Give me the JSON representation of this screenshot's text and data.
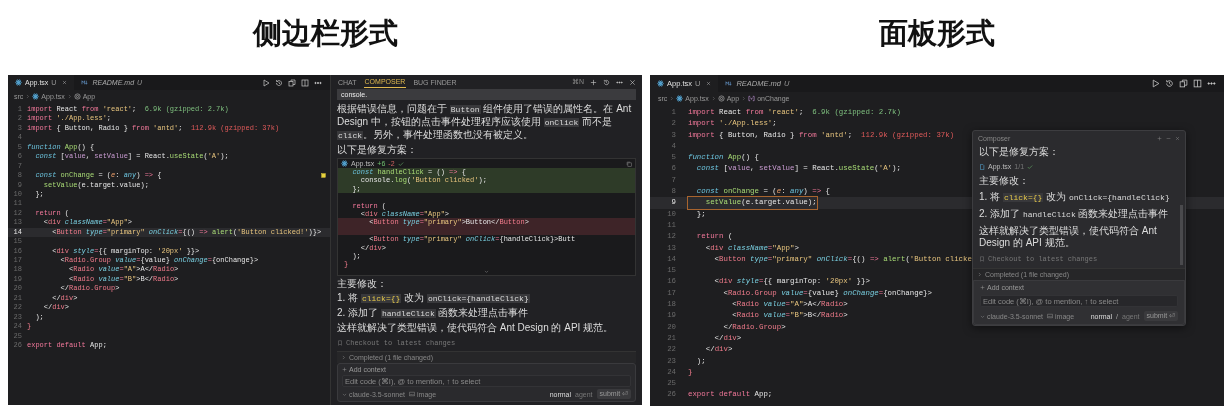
{
  "sections": [
    {
      "title": "侧边栏形式",
      "kind": "sidebar",
      "editor": {
        "tabs": [
          {
            "label": "App.tsx",
            "status": "U",
            "selected": true,
            "preview": false,
            "closable": true
          },
          {
            "label": "README.md",
            "status": "U",
            "selected": false,
            "preview": true,
            "closable": false
          }
        ],
        "breadcrumbs": [
          {
            "label": "src"
          },
          {
            "label": "App.tsx"
          },
          {
            "label": "App"
          }
        ],
        "lines": [
          {
            "number": "1",
            "current": false,
            "tokens": [
              {
                "kind": "kw",
                "text": "import"
              },
              {
                "kind": "txt",
                "text": " React "
              },
              {
                "kind": "kw",
                "text": "from"
              },
              {
                "kind": "str",
                "text": " 'react'"
              },
              {
                "kind": "txt",
                "text": ";  "
              },
              {
                "kind": "ok",
                "text": "6.9k (gzipped: 2.7k)"
              }
            ]
          },
          {
            "number": "2",
            "current": false,
            "tokens": [
              {
                "kind": "kw",
                "text": "import"
              },
              {
                "kind": "str",
                "text": " './App.less'"
              },
              {
                "kind": "txt",
                "text": ";"
              }
            ]
          },
          {
            "number": "3",
            "current": false,
            "tokens": [
              {
                "kind": "kw",
                "text": "import"
              },
              {
                "kind": "txt",
                "text": " { Button, Radio } "
              },
              {
                "kind": "kw",
                "text": "from"
              },
              {
                "kind": "str",
                "text": " 'antd'"
              },
              {
                "kind": "txt",
                "text": ";  "
              },
              {
                "kind": "big",
                "text": "112.9k (gzipped: 37k)"
              }
            ]
          },
          {
            "number": "4",
            "current": false
          },
          {
            "number": "5",
            "current": false,
            "tokens": [
              {
                "kind": "sto",
                "text": "function"
              },
              {
                "kind": "fn",
                "text": " App"
              },
              {
                "kind": "txt",
                "text": "() {"
              }
            ]
          },
          {
            "number": "6",
            "current": false,
            "tokens": [
              {
                "kind": "sto",
                "text": "  const"
              },
              {
                "kind": "txt",
                "text": " ["
              },
              {
                "kind": "var",
                "text": "value"
              },
              {
                "kind": "txt",
                "text": ", "
              },
              {
                "kind": "var",
                "text": "setValue"
              },
              {
                "kind": "txt",
                "text": "] = React."
              },
              {
                "kind": "fn",
                "text": "useState"
              },
              {
                "kind": "txt",
                "text": "("
              },
              {
                "kind": "str",
                "text": "'A'"
              },
              {
                "kind": "txt",
                "text": ");"
              }
            ]
          },
          {
            "number": "7",
            "current": false
          },
          {
            "number": "8",
            "current": false,
            "tokens": [
              {
                "kind": "sto",
                "text": "  const"
              },
              {
                "kind": "fn",
                "text": " onChange"
              },
              {
                "kind": "txt",
                "text": " = ("
              },
              {
                "kind": "param",
                "text": "e"
              },
              {
                "kind": "txt",
                "text": ": "
              },
              {
                "kind": "sto",
                "text": "any"
              },
              {
                "kind": "txt",
                "text": ") "
              },
              {
                "kind": "kw",
                "text": "=>"
              },
              {
                "kind": "txt",
                "text": " {"
              }
            ]
          },
          {
            "number": "9",
            "current": false,
            "tokens": [
              {
                "kind": "fn",
                "text": "    setValue"
              },
              {
                "kind": "txt",
                "text": "(e.target.value);"
              }
            ]
          },
          {
            "number": "10",
            "current": false,
            "tokens": [
              {
                "kind": "txt",
                "text": "  };"
              }
            ]
          },
          {
            "number": "11",
            "current": false
          },
          {
            "number": "12",
            "current": false,
            "tokens": [
              {
                "kind": "kw",
                "text": "  return"
              },
              {
                "kind": "txt",
                "text": " ("
              }
            ]
          },
          {
            "number": "13",
            "current": false,
            "tokens": [
              {
                "kind": "txt",
                "text": "    <"
              },
              {
                "kind": "tag",
                "text": "div"
              },
              {
                "kind": "attr",
                "text": " className"
              },
              {
                "kind": "kw",
                "text": "="
              },
              {
                "kind": "str",
                "text": "\"App\""
              },
              {
                "kind": "txt",
                "text": ">"
              }
            ]
          },
          {
            "number": "14",
            "current": true,
            "tokens": [
              {
                "kind": "txt",
                "text": "      <"
              },
              {
                "kind": "tag",
                "text": "Button"
              },
              {
                "kind": "attr",
                "text": " type"
              },
              {
                "kind": "kw",
                "text": "="
              },
              {
                "kind": "str",
                "text": "\"primary\""
              },
              {
                "kind": "attr",
                "text": " onClick"
              },
              {
                "kind": "kw",
                "text": "="
              },
              {
                "kind": "txt",
                "text": "{() "
              },
              {
                "kind": "kw",
                "text": "=>"
              },
              {
                "kind": "fn",
                "text": " alert"
              },
              {
                "kind": "txt",
                "text": "("
              },
              {
                "kind": "str",
                "text": "'Button clicked!'"
              },
              {
                "kind": "txt",
                "text": ")}>"
              }
            ]
          },
          {
            "number": "15",
            "current": false
          },
          {
            "number": "16",
            "current": false,
            "tokens": [
              {
                "kind": "txt",
                "text": "      <"
              },
              {
                "kind": "tag",
                "text": "div"
              },
              {
                "kind": "attr",
                "text": " style"
              },
              {
                "kind": "kw",
                "text": "="
              },
              {
                "kind": "txt",
                "text": "{{ marginTop: "
              },
              {
                "kind": "str",
                "text": "'20px'"
              },
              {
                "kind": "txt",
                "text": " }}>"
              }
            ]
          },
          {
            "number": "17",
            "current": false,
            "tokens": [
              {
                "kind": "txt",
                "text": "        <"
              },
              {
                "kind": "tag",
                "text": "Radio.Group"
              },
              {
                "kind": "attr",
                "text": " value"
              },
              {
                "kind": "kw",
                "text": "="
              },
              {
                "kind": "txt",
                "text": "{value} "
              },
              {
                "kind": "attr",
                "text": "onChange"
              },
              {
                "kind": "kw",
                "text": "="
              },
              {
                "kind": "txt",
                "text": "{onChange}>"
              }
            ]
          },
          {
            "number": "18",
            "current": false,
            "tokens": [
              {
                "kind": "txt",
                "text": "          <"
              },
              {
                "kind": "tag",
                "text": "Radio"
              },
              {
                "kind": "attr",
                "text": " value"
              },
              {
                "kind": "kw",
                "text": "="
              },
              {
                "kind": "str",
                "text": "\"A\""
              },
              {
                "kind": "txt",
                "text": ">A</"
              },
              {
                "kind": "tag",
                "text": "Radio"
              },
              {
                "kind": "txt",
                "text": ">"
              }
            ]
          },
          {
            "number": "19",
            "current": false,
            "tokens": [
              {
                "kind": "txt",
                "text": "          <"
              },
              {
                "kind": "tag",
                "text": "Radio"
              },
              {
                "kind": "attr",
                "text": " value"
              },
              {
                "kind": "kw",
                "text": "="
              },
              {
                "kind": "str",
                "text": "\"B\""
              },
              {
                "kind": "txt",
                "text": ">B</"
              },
              {
                "kind": "tag",
                "text": "Radio"
              },
              {
                "kind": "txt",
                "text": ">"
              }
            ]
          },
          {
            "number": "20",
            "current": false,
            "tokens": [
              {
                "kind": "txt",
                "text": "        </"
              },
              {
                "kind": "tag",
                "text": "Radio.Group"
              },
              {
                "kind": "txt",
                "text": ">"
              }
            ]
          },
          {
            "number": "21",
            "current": false,
            "tokens": [
              {
                "kind": "txt",
                "text": "      </"
              },
              {
                "kind": "tag",
                "text": "div"
              },
              {
                "kind": "txt",
                "text": ">"
              }
            ]
          },
          {
            "number": "22",
            "current": false,
            "tokens": [
              {
                "kind": "txt",
                "text": "    </"
              },
              {
                "kind": "tag",
                "text": "div"
              },
              {
                "kind": "txt",
                "text": ">"
              }
            ]
          },
          {
            "number": "23",
            "current": false,
            "tokens": [
              {
                "kind": "txt",
                "text": "  );"
              }
            ]
          },
          {
            "number": "24",
            "current": false,
            "tokens": [
              {
                "kind": "tag",
                "text": "}"
              }
            ]
          },
          {
            "number": "25",
            "current": false
          },
          {
            "number": "26",
            "current": false,
            "tokens": [
              {
                "kind": "kw",
                "text": "export"
              },
              {
                "kind": "kw",
                "text": " default"
              },
              {
                "kind": "txt",
                "text": " App;"
              }
            ]
          }
        ]
      },
      "composer": {
        "tabs": [
          {
            "label": "CHAT",
            "selected": false
          },
          {
            "label": "COMPOSER",
            "selected": true
          },
          {
            "label": "BUG FINDER",
            "selected": false
          }
        ],
        "shortcut": "⌘N",
        "user_message": "console.",
        "content": [
          {
            "kind": "para",
            "segments": [
              {
                "kind": "text",
                "text": "根据错误信息，问题在于 "
              },
              {
                "kind": "code",
                "text": "Button"
              },
              {
                "kind": "text",
                "text": " 组件使用了错误的属性名。在 Ant Design 中，按钮的点击事件处理程序应该使用 "
              },
              {
                "kind": "code",
                "text": "onClick"
              },
              {
                "kind": "text",
                "text": " 而不是 "
              },
              {
                "kind": "code",
                "text": "click"
              },
              {
                "kind": "text",
                "text": "。另外，事件处理函数也没有被定义。"
              }
            ]
          },
          {
            "kind": "para",
            "segments": [
              {
                "kind": "text",
                "text": "以下是修复方案："
              }
            ]
          },
          {
            "kind": "diff",
            "file": "App.tsx",
            "added": "+6",
            "removed": "-2",
            "lines": [
              {
                "kind": "added",
                "tokens": [
                  {
                    "kind": "sto",
                    "text": "  const"
                  },
                  {
                    "kind": "fn",
                    "text": " handleClick"
                  },
                  {
                    "kind": "txt",
                    "text": " = () "
                  },
                  {
                    "kind": "kw",
                    "text": "=>"
                  },
                  {
                    "kind": "txt",
                    "text": " {"
                  }
                ]
              },
              {
                "kind": "added",
                "tokens": [
                  {
                    "kind": "txt",
                    "text": "    console."
                  },
                  {
                    "kind": "fn",
                    "text": "log"
                  },
                  {
                    "kind": "txt",
                    "text": "("
                  },
                  {
                    "kind": "str",
                    "text": "'Button clicked'"
                  },
                  {
                    "kind": "txt",
                    "text": ");"
                  }
                ]
              },
              {
                "kind": "added",
                "tokens": [
                  {
                    "kind": "txt",
                    "text": "  };"
                  }
                ]
              },
              {
                "kind": "context"
              },
              {
                "kind": "context",
                "tokens": [
                  {
                    "kind": "kw",
                    "text": "  return"
                  },
                  {
                    "kind": "txt",
                    "text": " ("
                  }
                ]
              },
              {
                "kind": "context",
                "tokens": [
                  {
                    "kind": "txt",
                    "text": "    <"
                  },
                  {
                    "kind": "tag",
                    "text": "div"
                  },
                  {
                    "kind": "attr",
                    "text": " className"
                  },
                  {
                    "kind": "kw",
                    "text": "="
                  },
                  {
                    "kind": "str",
                    "text": "\"App\""
                  },
                  {
                    "kind": "txt",
                    "text": ">"
                  }
                ]
              },
              {
                "kind": "removed",
                "tokens": [
                  {
                    "kind": "txt",
                    "text": "      <"
                  },
                  {
                    "kind": "tag",
                    "text": "Button"
                  },
                  {
                    "kind": "attr",
                    "text": " type"
                  },
                  {
                    "kind": "kw",
                    "text": "="
                  },
                  {
                    "kind": "str",
                    "text": "\"primary\""
                  },
                  {
                    "kind": "txt",
                    "text": ">Button</"
                  },
                  {
                    "kind": "tag",
                    "text": "Button"
                  },
                  {
                    "kind": "txt",
                    "text": ">"
                  }
                ]
              },
              {
                "kind": "removed"
              },
              {
                "kind": "context",
                "tokens": [
                  {
                    "kind": "txt",
                    "text": "      <"
                  },
                  {
                    "kind": "tag",
                    "text": "Button"
                  },
                  {
                    "kind": "attr",
                    "text": " type"
                  },
                  {
                    "kind": "kw",
                    "text": "="
                  },
                  {
                    "kind": "str",
                    "text": "\"primary\""
                  },
                  {
                    "kind": "attr",
                    "text": " onClick"
                  },
                  {
                    "kind": "kw",
                    "text": "="
                  },
                  {
                    "kind": "txt",
                    "text": "{handleClick}>Butt"
                  }
                ]
              },
              {
                "kind": "context",
                "tokens": [
                  {
                    "kind": "txt",
                    "text": "    </"
                  },
                  {
                    "kind": "tag",
                    "text": "div"
                  },
                  {
                    "kind": "txt",
                    "text": ">"
                  }
                ]
              },
              {
                "kind": "context",
                "tokens": [
                  {
                    "kind": "txt",
                    "text": "  );"
                  }
                ]
              },
              {
                "kind": "context",
                "tokens": [
                  {
                    "kind": "tag",
                    "text": "}"
                  }
                ]
              }
            ]
          },
          {
            "kind": "para",
            "segments": [
              {
                "kind": "text",
                "text": "主要修改："
              }
            ]
          },
          {
            "kind": "para",
            "segments": [
              {
                "kind": "text",
                "text": "1. 将 "
              },
              {
                "kind": "code_hl",
                "text": "click={}"
              },
              {
                "kind": "text",
                "text": " 改为 "
              },
              {
                "kind": "code",
                "text": "onClick={handleClick}"
              }
            ]
          },
          {
            "kind": "para",
            "segments": [
              {
                "kind": "text",
                "text": "2. 添加了 "
              },
              {
                "kind": "code",
                "text": "handleClick"
              },
              {
                "kind": "text",
                "text": " 函数来处理点击事件"
              }
            ]
          },
          {
            "kind": "para",
            "segments": [
              {
                "kind": "text",
                "text": "这样就解决了类型错误，使代码符合 Ant Design 的 API 规范。"
              }
            ]
          },
          {
            "kind": "checkout",
            "label": "Checkout to latest changes"
          }
        ],
        "completed": "Completed (1 file changed)",
        "input": {
          "add_context": "Add context",
          "placeholder": "Edit code (⌘I), @ to mention, ↑ to select",
          "model": "claude-3.5-sonnet",
          "image": "image",
          "modes": [
            {
              "label": "normal",
              "selected": true
            },
            {
              "label": "agent",
              "selected": false
            }
          ],
          "submit": "submit ⏎"
        }
      }
    },
    {
      "title": "面板形式",
      "kind": "panel",
      "editor": {
        "tabs": [
          {
            "label": "App.tsx",
            "status": "U",
            "selected": true,
            "preview": false,
            "closable": true
          },
          {
            "label": "README.md",
            "status": "U",
            "selected": false,
            "preview": true,
            "closable": false
          }
        ],
        "breadcrumbs": [
          {
            "label": "src"
          },
          {
            "label": "App.tsx"
          },
          {
            "label": "App"
          },
          {
            "label": "onChange"
          }
        ],
        "lines": [
          {
            "number": "1",
            "current": false,
            "tokens": [
              {
                "kind": "kw",
                "text": "import"
              },
              {
                "kind": "txt",
                "text": " React "
              },
              {
                "kind": "kw",
                "text": "from"
              },
              {
                "kind": "str",
                "text": " 'react'"
              },
              {
                "kind": "txt",
                "text": ";  "
              },
              {
                "kind": "ok",
                "text": "6.9k (gzipped: 2.7k)"
              }
            ]
          },
          {
            "number": "2",
            "current": false,
            "tokens": [
              {
                "kind": "kw",
                "text": "import"
              },
              {
                "kind": "str",
                "text": " './App.less'"
              },
              {
                "kind": "txt",
                "text": ";"
              }
            ]
          },
          {
            "number": "3",
            "current": false,
            "tokens": [
              {
                "kind": "kw",
                "text": "import"
              },
              {
                "kind": "txt",
                "text": " { Button, Radio } "
              },
              {
                "kind": "kw",
                "text": "from"
              },
              {
                "kind": "str",
                "text": " 'antd'"
              },
              {
                "kind": "txt",
                "text": ";  "
              },
              {
                "kind": "big",
                "text": "112.9k (gzipped: 37k)"
              }
            ]
          },
          {
            "number": "4",
            "current": false
          },
          {
            "number": "5",
            "current": false,
            "tokens": [
              {
                "kind": "sto",
                "text": "function"
              },
              {
                "kind": "fn",
                "text": " App"
              },
              {
                "kind": "txt",
                "text": "() {"
              }
            ]
          },
          {
            "number": "6",
            "current": false,
            "tokens": [
              {
                "kind": "sto",
                "text": "  const"
              },
              {
                "kind": "txt",
                "text": " ["
              },
              {
                "kind": "var",
                "text": "value"
              },
              {
                "kind": "txt",
                "text": ", "
              },
              {
                "kind": "var",
                "text": "setValue"
              },
              {
                "kind": "txt",
                "text": "] = React."
              },
              {
                "kind": "fn",
                "text": "useState"
              },
              {
                "kind": "txt",
                "text": "("
              },
              {
                "kind": "str",
                "text": "'A'"
              },
              {
                "kind": "txt",
                "text": ");"
              }
            ]
          },
          {
            "number": "7",
            "current": false
          },
          {
            "number": "8",
            "current": false,
            "tokens": [
              {
                "kind": "sto",
                "text": "  const"
              },
              {
                "kind": "fn",
                "text": " onChange"
              },
              {
                "kind": "txt",
                "text": " = ("
              },
              {
                "kind": "param",
                "text": "e"
              },
              {
                "kind": "txt",
                "text": ": "
              },
              {
                "kind": "sto",
                "text": "any"
              },
              {
                "kind": "txt",
                "text": ") "
              },
              {
                "kind": "kw",
                "text": "=>"
              },
              {
                "kind": "txt",
                "text": " {"
              }
            ]
          },
          {
            "number": "9",
            "current": true,
            "tokens": [
              {
                "kind": "fn",
                "text": "    setValue"
              },
              {
                "kind": "txt",
                "text": "(e.target.value);"
              }
            ]
          },
          {
            "number": "10",
            "current": false,
            "tokens": [
              {
                "kind": "txt",
                "text": "  };"
              }
            ]
          },
          {
            "number": "11",
            "current": false
          },
          {
            "number": "12",
            "current": false,
            "tokens": [
              {
                "kind": "kw",
                "text": "  return"
              },
              {
                "kind": "txt",
                "text": " ("
              }
            ]
          },
          {
            "number": "13",
            "current": false,
            "tokens": [
              {
                "kind": "txt",
                "text": "    <"
              },
              {
                "kind": "tag",
                "text": "div"
              },
              {
                "kind": "attr",
                "text": " className"
              },
              {
                "kind": "kw",
                "text": "="
              },
              {
                "kind": "str",
                "text": "\"App\""
              },
              {
                "kind": "txt",
                "text": ">"
              }
            ]
          },
          {
            "number": "14",
            "current": false,
            "tokens": [
              {
                "kind": "txt",
                "text": "      <"
              },
              {
                "kind": "tag",
                "text": "Button"
              },
              {
                "kind": "attr",
                "text": " type"
              },
              {
                "kind": "kw",
                "text": "="
              },
              {
                "kind": "str",
                "text": "\"primary\""
              },
              {
                "kind": "attr",
                "text": " onClick"
              },
              {
                "kind": "kw",
                "text": "="
              },
              {
                "kind": "txt",
                "text": "{() "
              },
              {
                "kind": "kw",
                "text": "=>"
              },
              {
                "kind": "fn",
                "text": " alert"
              },
              {
                "kind": "txt",
                "text": "("
              },
              {
                "kind": "str",
                "text": "'Button clicke"
              }
            ]
          },
          {
            "number": "15",
            "current": false
          },
          {
            "number": "16",
            "current": false,
            "tokens": [
              {
                "kind": "txt",
                "text": "      <"
              },
              {
                "kind": "tag",
                "text": "div"
              },
              {
                "kind": "attr",
                "text": " style"
              },
              {
                "kind": "kw",
                "text": "="
              },
              {
                "kind": "txt",
                "text": "{{ marginTop: "
              },
              {
                "kind": "str",
                "text": "'20px'"
              },
              {
                "kind": "txt",
                "text": " }}>"
              }
            ]
          },
          {
            "number": "17",
            "current": false,
            "tokens": [
              {
                "kind": "txt",
                "text": "        <"
              },
              {
                "kind": "tag",
                "text": "Radio.Group"
              },
              {
                "kind": "attr",
                "text": " value"
              },
              {
                "kind": "kw",
                "text": "="
              },
              {
                "kind": "txt",
                "text": "{value} "
              },
              {
                "kind": "attr",
                "text": "onChange"
              },
              {
                "kind": "kw",
                "text": "="
              },
              {
                "kind": "txt",
                "text": "{onChange}>"
              }
            ]
          },
          {
            "number": "18",
            "current": false,
            "tokens": [
              {
                "kind": "txt",
                "text": "          <"
              },
              {
                "kind": "tag",
                "text": "Radio"
              },
              {
                "kind": "attr",
                "text": " value"
              },
              {
                "kind": "kw",
                "text": "="
              },
              {
                "kind": "str",
                "text": "\"A\""
              },
              {
                "kind": "txt",
                "text": ">A</"
              },
              {
                "kind": "tag",
                "text": "Radio"
              },
              {
                "kind": "txt",
                "text": ">"
              }
            ]
          },
          {
            "number": "19",
            "current": false,
            "tokens": [
              {
                "kind": "txt",
                "text": "          <"
              },
              {
                "kind": "tag",
                "text": "Radio"
              },
              {
                "kind": "attr",
                "text": " value"
              },
              {
                "kind": "kw",
                "text": "="
              },
              {
                "kind": "str",
                "text": "\"B\""
              },
              {
                "kind": "txt",
                "text": ">B</"
              },
              {
                "kind": "tag",
                "text": "Radio"
              },
              {
                "kind": "txt",
                "text": ">"
              }
            ]
          },
          {
            "number": "20",
            "current": false,
            "tokens": [
              {
                "kind": "txt",
                "text": "        </"
              },
              {
                "kind": "tag",
                "text": "Radio.Group"
              },
              {
                "kind": "txt",
                "text": ">"
              }
            ]
          },
          {
            "number": "21",
            "current": false,
            "tokens": [
              {
                "kind": "txt",
                "text": "      </"
              },
              {
                "kind": "tag",
                "text": "div"
              },
              {
                "kind": "txt",
                "text": ">"
              }
            ]
          },
          {
            "number": "22",
            "current": false,
            "tokens": [
              {
                "kind": "txt",
                "text": "    </"
              },
              {
                "kind": "tag",
                "text": "div"
              },
              {
                "kind": "txt",
                "text": ">"
              }
            ]
          },
          {
            "number": "23",
            "current": false,
            "tokens": [
              {
                "kind": "txt",
                "text": "  );"
              }
            ]
          },
          {
            "number": "24",
            "current": false,
            "tokens": [
              {
                "kind": "tag",
                "text": "}"
              }
            ]
          },
          {
            "number": "25",
            "current": false
          },
          {
            "number": "26",
            "current": false,
            "tokens": [
              {
                "kind": "kw",
                "text": "export"
              },
              {
                "kind": "kw",
                "text": " default"
              },
              {
                "kind": "txt",
                "text": " App;"
              }
            ]
          }
        ]
      },
      "composer": {
        "title": "Composer",
        "content": [
          {
            "kind": "para",
            "segments": [
              {
                "kind": "text",
                "text": "以下是修复方案："
              }
            ]
          },
          {
            "kind": "file_chip",
            "file": "App.tsx",
            "count": "1/1"
          },
          {
            "kind": "para",
            "segments": [
              {
                "kind": "text",
                "text": "主要修改："
              }
            ]
          },
          {
            "kind": "para",
            "segments": [
              {
                "kind": "text",
                "text": "1. 将 "
              },
              {
                "kind": "code_hl",
                "text": "click={}"
              },
              {
                "kind": "text",
                "text": " 改为 "
              },
              {
                "kind": "mono",
                "text": "onClick={handleClick}"
              }
            ]
          },
          {
            "kind": "para",
            "segments": [
              {
                "kind": "text",
                "text": "2. 添加了 "
              },
              {
                "kind": "mono",
                "text": "handleClick"
              },
              {
                "kind": "text",
                "text": " 函数来处理点击事件"
              }
            ]
          },
          {
            "kind": "para",
            "segments": [
              {
                "kind": "text",
                "text": "这样就解决了类型错误，使代码符合 Ant Design 的 API 规范。"
              }
            ]
          },
          {
            "kind": "checkout",
            "label": "Checkout to latest changes"
          }
        ],
        "completed": "Completed (1 file changed)",
        "input": {
          "add_context": "Add context",
          "placeholder": "Edit code (⌘I), @ to mention, ↑ to select",
          "model": "claude-3.5-sonnet",
          "image": "image",
          "modes": [
            {
              "label": "normal",
              "selected": true
            },
            {
              "label": "agent",
              "selected": false
            }
          ],
          "mode_separator": "/",
          "submit": "submit ⏎"
        }
      }
    }
  ]
}
